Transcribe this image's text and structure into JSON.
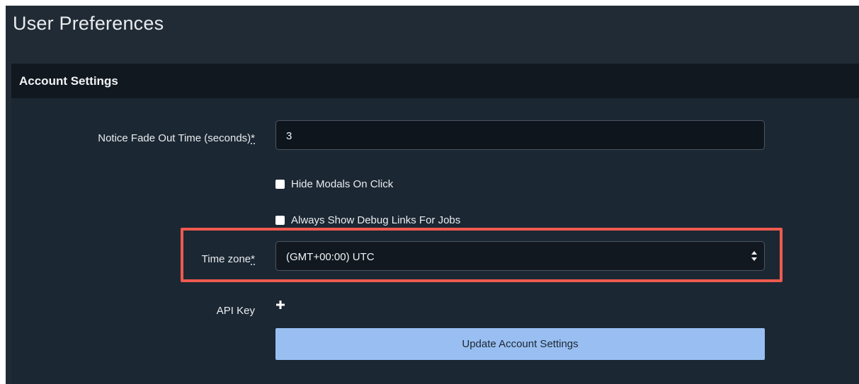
{
  "page": {
    "title": "User Preferences"
  },
  "account_settings": {
    "header": "Account Settings",
    "fade_out": {
      "label": "Notice Fade Out Time (seconds)",
      "required_mark": "*",
      "value": "3"
    },
    "hide_modals": {
      "label": "Hide Modals On Click",
      "checked": false
    },
    "debug_links": {
      "label": "Always Show Debug Links For Jobs",
      "checked": false
    },
    "time_zone": {
      "label": "Time zone",
      "required_mark": "*",
      "selected": "(GMT+00:00) UTC"
    },
    "api_key": {
      "label": "API Key",
      "add_icon": "plus-icon"
    },
    "submit_label": "Update Account Settings"
  },
  "colors": {
    "background": "#212b35",
    "panel_header": "#111820",
    "button": "#99bff2",
    "highlight": "#ef5a4f"
  }
}
